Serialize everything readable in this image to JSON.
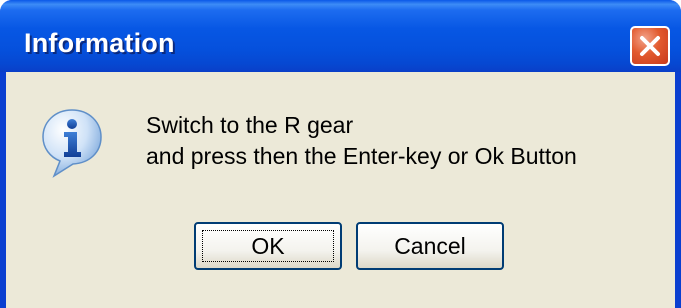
{
  "window": {
    "title": "Information"
  },
  "message": {
    "line1": "Switch to the R gear",
    "line2": "and press then the Enter-key or Ok Button"
  },
  "buttons": {
    "ok_label": "OK",
    "cancel_label": "Cancel"
  },
  "icons": {
    "message_icon": "information-icon",
    "close_icon": "close-icon"
  },
  "colors": {
    "titlebar": "#0550dc",
    "client_background": "#ece9d8",
    "close_button": "#e25a2e"
  }
}
